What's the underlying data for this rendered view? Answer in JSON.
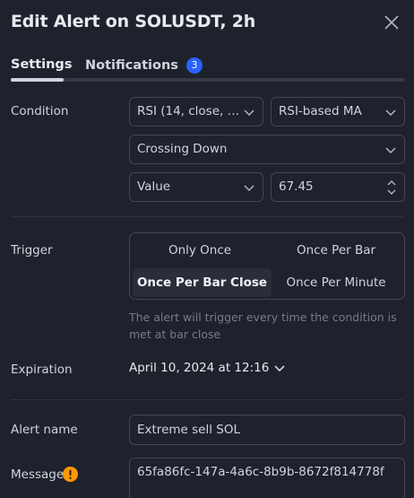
{
  "header": {
    "title": "Edit Alert on SOLUSDT, 2h"
  },
  "tabs": [
    {
      "label": "Settings",
      "active": true
    },
    {
      "label": "Notifications",
      "badge": "3"
    }
  ],
  "condition": {
    "label": "Condition",
    "indicator": "RSI (14, close, S...",
    "source": "RSI-based MA",
    "operator": "Crossing Down",
    "value_type": "Value",
    "value": "67.45"
  },
  "trigger": {
    "label": "Trigger",
    "options": [
      "Only Once",
      "Once Per Bar",
      "Once Per Bar Close",
      "Once Per Minute"
    ],
    "selected": "Once Per Bar Close",
    "hint": "The alert will trigger every time the condition is met at bar close"
  },
  "expiration": {
    "label": "Expiration",
    "value": "April 10, 2024 at 12:16"
  },
  "alert_name": {
    "label": "Alert name",
    "value": "Extreme sell SOL"
  },
  "message": {
    "label": "Message",
    "value": "65fa86fc-147a-4a6c-8b9b-8672f814778f"
  },
  "colors": {
    "background": "#1e222d",
    "accent": "#2962ff",
    "warning": "#ff9800",
    "border": "#434651"
  },
  "icons": {
    "close": "close-icon",
    "dropdown": "chevron-down-icon",
    "spinner": "stepper-icon",
    "warning": "warning-icon"
  }
}
